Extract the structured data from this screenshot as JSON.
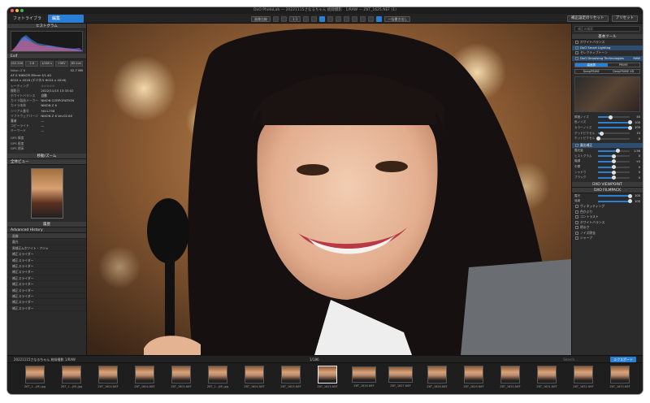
{
  "window": {
    "title": "DxO PhotoLab — 20221115さなるちゃん 総録撮影　1/RAW — Z6T_1625.NEF (1)"
  },
  "toolbar": {
    "tab_library": "フォトライブラリ",
    "tab_edit": "編集",
    "compare_label": "画像比較",
    "zoom_label": "1:1",
    "batch_label": "一括書き出し",
    "preset_apply": "補正設定のリセット",
    "preset": "プリセット"
  },
  "left": {
    "histogram_title": "ヒストグラム",
    "exif_title": "Exif",
    "exif_values": [
      "ISO 200",
      "2.8",
      "1/160 s",
      "+0EV",
      "85 mm"
    ],
    "lens_line": "Nikon Z 6",
    "lens_size": "52.7 MB",
    "lens_model": "AF-S NIKKOR 85mm f/1.4G",
    "dimensions": "6024 x 4016 (デジタル 6024 x 4016)",
    "meta": [
      {
        "k": "レーティング",
        "v": "☆☆☆☆☆"
      },
      {
        "k": "撮影日",
        "v": "2022/11/15 13:33:02"
      },
      {
        "k": "ホワイトバランス",
        "v": "自動"
      },
      {
        "k": "カメラ製造メーカー",
        "v": "NIKON CORPORATION"
      },
      {
        "k": "カメラ本体",
        "v": "NIKON Z 6"
      },
      {
        "k": "シリアル番号",
        "v": "3011758"
      },
      {
        "k": "ソフトウェアバージョン",
        "v": "NIKON Z 6 Ver.02.60"
      },
      {
        "k": "著者",
        "v": "—"
      },
      {
        "k": "コピーライト",
        "v": "—"
      },
      {
        "k": "キーワード",
        "v": "—"
      }
    ],
    "gps": [
      {
        "k": "GPS 緯度",
        "v": ""
      },
      {
        "k": "GPS 経度",
        "v": ""
      },
      {
        "k": "GPS 標高",
        "v": ""
      }
    ],
    "move_title": "移動/ズーム",
    "navigator_title": "全体ビュー",
    "history_header": "履歴",
    "history_title": "Advanced History",
    "history": [
      "画像",
      "露光",
      "黒補正&ホワイト・アジャ",
      "補正スライダー",
      "補正スライダー",
      "補正スライダー",
      "補正スライダー",
      "補正スライダー",
      "補正スライダー",
      "補正スライダー",
      "補正スライダー",
      "補正スライダー",
      "補正スライダー"
    ],
    "history_meta": [
      "1/60 100",
      "1/40 000"
    ]
  },
  "right": {
    "search_placeholder": "補正の検索",
    "section_basic": "基本ツール",
    "wb_label": "ホワイトバランス",
    "smart_lighting": "DxO Smart Lighting",
    "selective_tone": "セレクティブトーン",
    "denoise": "DxO Denoising Technologies",
    "denoise_mode": "RAW",
    "seg": [
      "高品質",
      "PRIME",
      "DeepPRIME"
    ],
    "seg2": [
      "DeepPRIME",
      "DeepPRIME XD"
    ],
    "sliders_1": [
      {
        "lbl": "輝度ノイズ",
        "val": "40",
        "pct": 40
      },
      {
        "lbl": "色ノイズ",
        "val": "100",
        "pct": 100
      },
      {
        "lbl": "カラーノイズ",
        "val": "100",
        "pct": 100
      },
      {
        "lbl": "デッドピクセル",
        "val": "10",
        "pct": 10
      },
      {
        "lbl": "ホットピクセル",
        "val": "0",
        "pct": 0
      }
    ],
    "exposure_label": "露出補正",
    "sliders_2": [
      {
        "lbl": "露光量",
        "val": "1.56",
        "pct": 62
      },
      {
        "lbl": "ヒストグラム",
        "val": "0",
        "pct": 50
      },
      {
        "lbl": "階調",
        "val": "+0",
        "pct": 50
      },
      {
        "lbl": "中間",
        "val": "0",
        "pct": 50
      },
      {
        "lbl": "シャドウ",
        "val": "0",
        "pct": 50
      },
      {
        "lbl": "ブラック",
        "val": "0",
        "pct": 50
      }
    ],
    "viewpoint": "DXO VIEWPOINT",
    "filmpack": "DXO FILMPACK",
    "sliders_3": [
      {
        "lbl": "露光",
        "val": "100",
        "pct": 100
      },
      {
        "lbl": "強度",
        "val": "100",
        "pct": 100
      }
    ],
    "misc": [
      "ヴィネッティング",
      "色かぶり",
      "コントラスト",
      "ホワイトバランス",
      "明るさ",
      "ノイズ除去",
      "シャープ"
    ]
  },
  "filmbar": {
    "folder": "20221115さなるちゃん 総録撮影 1/RAW",
    "count": "1/186",
    "export_btn": "エクスポート",
    "search": "Search…"
  },
  "filmstrip": [
    {
      "cap": "Z6T_1...(M).jpg",
      "land": false,
      "sel": false
    },
    {
      "cap": "Z6T_1...(M).jpg",
      "land": false,
      "sel": false
    },
    {
      "cap": "Z6T_1604.NEF",
      "land": false,
      "sel": false
    },
    {
      "cap": "Z6T_1604.NEF",
      "land": false,
      "sel": false
    },
    {
      "cap": "Z6T_1605.NEF",
      "land": false,
      "sel": false
    },
    {
      "cap": "Z6T_1...(M).jpg",
      "land": false,
      "sel": false
    },
    {
      "cap": "Z6T_1604.NEF",
      "land": false,
      "sel": false
    },
    {
      "cap": "Z6T_1605.NEF",
      "land": false,
      "sel": false
    },
    {
      "cap": "Z6T_1625.NEF",
      "land": false,
      "sel": true
    },
    {
      "cap": "Z6T_1626.NEF",
      "land": true,
      "sel": false
    },
    {
      "cap": "Z6T_1627.NEF",
      "land": true,
      "sel": false
    },
    {
      "cap": "Z6T_1628.NEF",
      "land": false,
      "sel": false
    },
    {
      "cap": "Z6T_1629.NEF",
      "land": false,
      "sel": false
    },
    {
      "cap": "Z6T_1630.NEF",
      "land": false,
      "sel": false
    },
    {
      "cap": "Z6T_1631.NEF",
      "land": false,
      "sel": false
    },
    {
      "cap": "Z6T_1632.NEF",
      "land": false,
      "sel": false
    },
    {
      "cap": "Z6T_1633.NEF",
      "land": false,
      "sel": false
    }
  ],
  "colors": {
    "accent": "#2a7fd4",
    "panel": "#2b2b2b",
    "header": "#3a3a3a"
  }
}
